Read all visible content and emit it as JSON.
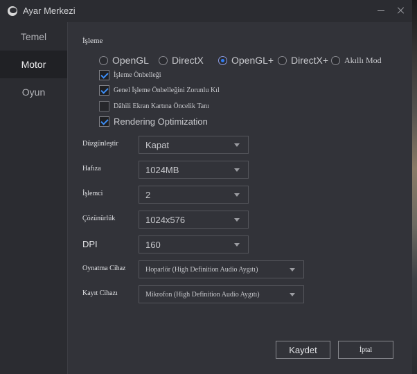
{
  "window": {
    "title": "Ayar Merkezi"
  },
  "sidebar": {
    "items": [
      {
        "label": "Temel",
        "active": false
      },
      {
        "label": "Motor",
        "active": true
      },
      {
        "label": "Oyun",
        "active": false
      }
    ]
  },
  "rendering": {
    "section_title": "İşleme",
    "modes": [
      {
        "label": "OpenGL",
        "selected": false
      },
      {
        "label": "DirectX",
        "selected": false
      },
      {
        "label": "OpenGL+",
        "selected": true
      },
      {
        "label": "DirectX+",
        "selected": false
      },
      {
        "label": "Akıllı Mod",
        "selected": false
      }
    ],
    "options": [
      {
        "label": "İşleme Önbelleği",
        "checked": true
      },
      {
        "label": "Genel İşleme Önbelleğini Zorunlu Kıl",
        "checked": true
      },
      {
        "label": "Dâhili Ekran Kartına Öncelik Tanı",
        "checked": false
      },
      {
        "label": "Rendering Optimization",
        "checked": true
      }
    ]
  },
  "settings": {
    "antialias": {
      "label": "Düzgünleştir",
      "value": "Kapat"
    },
    "memory": {
      "label": "Hafıza",
      "value": "1024MB"
    },
    "cpu": {
      "label": "İşlemci",
      "value": "2"
    },
    "resolution": {
      "label": "Çözünürlük",
      "value": "1024x576"
    },
    "dpi": {
      "label": "DPI",
      "value": "160"
    },
    "playback": {
      "label": "Oynatma Cihazı",
      "value": "Hoparlör (High Definition Audio Aygıtı)"
    },
    "recording": {
      "label": "Kayıt Cihazı",
      "value": "Mikrofon (High Definition Audio Aygıtı)"
    }
  },
  "actions": {
    "save_label": "Kaydet",
    "cancel_label": "İptal"
  },
  "colors": {
    "accent": "#2f7cf6",
    "panel": "#323339",
    "sidebar_active": "#202125"
  }
}
